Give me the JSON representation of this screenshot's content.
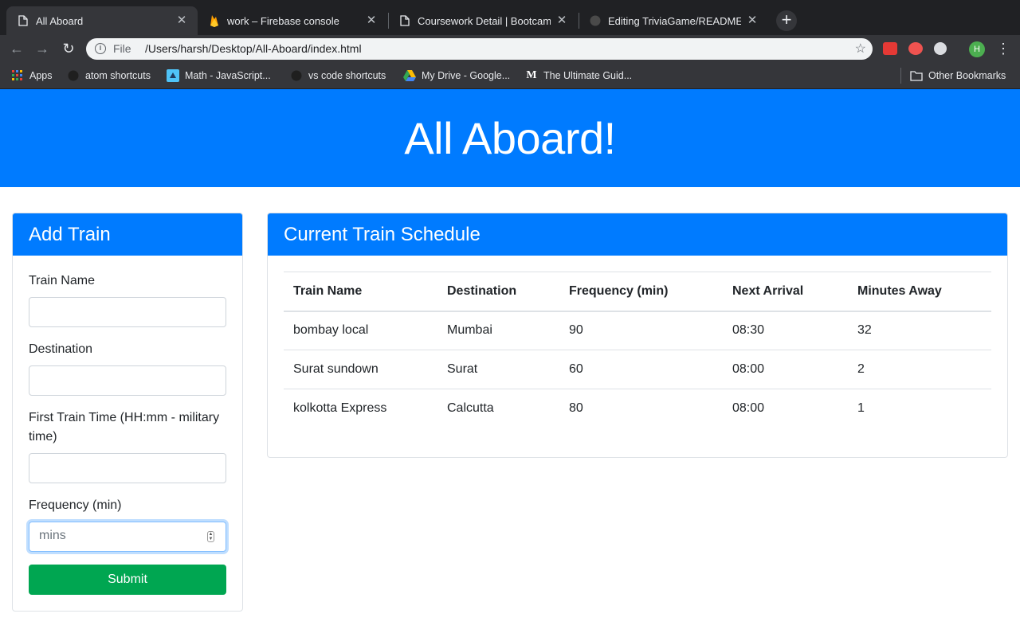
{
  "browser": {
    "tabs": [
      {
        "title": "All Aboard",
        "icon": "page-icon"
      },
      {
        "title": "work – Firebase console",
        "icon": "firebase-icon"
      },
      {
        "title": "Coursework Detail | Bootcamp",
        "icon": "page-icon"
      },
      {
        "title": "Editing TriviaGame/README.m",
        "icon": "github-icon"
      }
    ],
    "omnibox": {
      "scheme": "File",
      "url": "/Users/harsh/Desktop/All-Aboard/index.html"
    },
    "avatar_letter": "H",
    "bookmarks": [
      {
        "label": "Apps",
        "icon": "apps-grid-icon"
      },
      {
        "label": "atom shortcuts",
        "icon": "github-icon"
      },
      {
        "label": "Math - JavaScript...",
        "icon": "bookmark-favicon-icon"
      },
      {
        "label": "vs code shortcuts",
        "icon": "github-icon"
      },
      {
        "label": "My Drive - Google...",
        "icon": "google-drive-icon"
      },
      {
        "label": "The Ultimate Guid...",
        "icon": "medium-icon"
      },
      {
        "label": "Other Bookmarks",
        "icon": "folder-icon"
      }
    ]
  },
  "page": {
    "title": "All Aboard!",
    "accent_color": "#007bff",
    "submit_color": "#00a651",
    "form": {
      "header": "Add Train",
      "train_name_label": "Train Name",
      "destination_label": "Destination",
      "first_train_label": "First Train Time (HH:mm - military time)",
      "frequency_label": "Frequency (min)",
      "frequency_placeholder": "mins",
      "submit_label": "Submit"
    },
    "schedule": {
      "header": "Current Train Schedule",
      "columns": [
        "Train Name",
        "Destination",
        "Frequency (min)",
        "Next Arrival",
        "Minutes Away"
      ],
      "rows": [
        [
          "bombay local",
          "Mumbai",
          "90",
          "08:30",
          "32"
        ],
        [
          "Surat sundown",
          "Surat",
          "60",
          "08:00",
          "2"
        ],
        [
          "kolkotta Express",
          "Calcutta",
          "80",
          "08:00",
          "1"
        ]
      ]
    }
  }
}
